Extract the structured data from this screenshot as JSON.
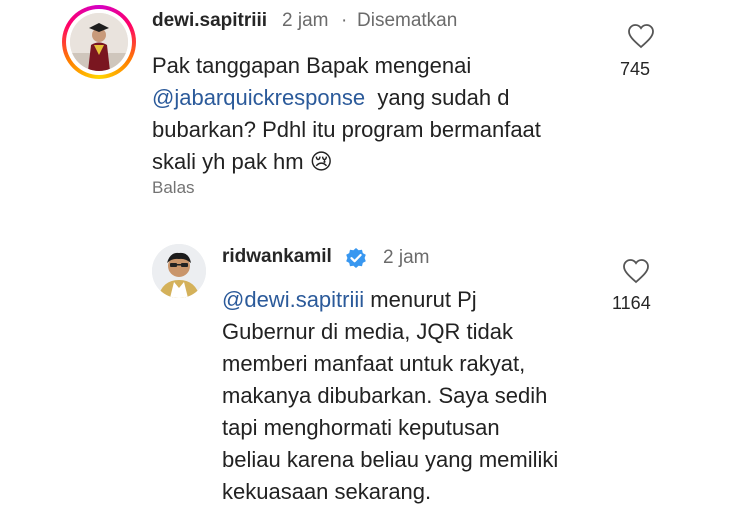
{
  "comment1": {
    "username": "dewi.sapitriii",
    "time": "2 jam",
    "separator": "·",
    "pinned_label": "Disematkan",
    "line1": "Pak tanggapan Bapak mengenai",
    "mention": "@jabarquickresponse",
    "line2_rest": "yang sudah d",
    "line3": "bubarkan? Pdhl itu program bermanfaat",
    "line4": "skali yh pak  hm",
    "emoji": "😢",
    "reply_label": "Balas",
    "likes": "745"
  },
  "comment2": {
    "username": "ridwankamil",
    "time": "2 jam",
    "mention": "@dewi.sapitriii",
    "line1_rest": "menurut Pj",
    "line2": "Gubernur di media, JQR tidak",
    "line3": "memberi manfaat untuk rakyat,",
    "line4": "makanya dibubarkan. Saya sedih",
    "line5": "tapi menghormati keputusan",
    "line6": "beliau karena beliau yang memiliki",
    "line7": "kekuasaan sekarang.",
    "likes": "1164"
  },
  "icons": {
    "heart": "heart-icon",
    "verified": "verified-badge-icon",
    "verified_color": "#3897f0"
  }
}
